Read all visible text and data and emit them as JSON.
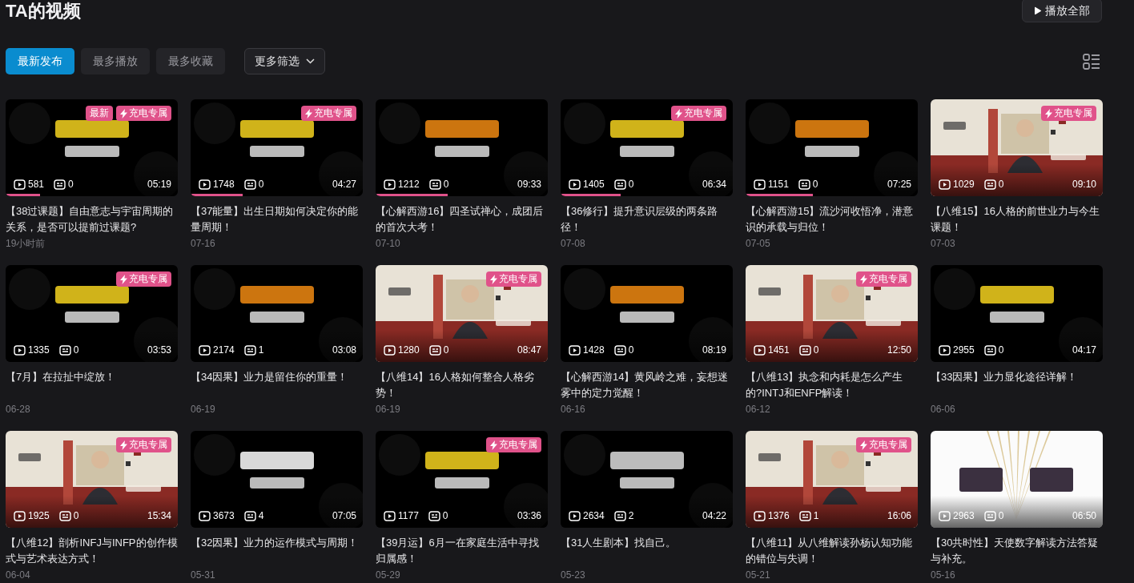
{
  "page_title": "TA的视频",
  "play_all_button": "播放全部",
  "sort_tabs": [
    {
      "label": "最新发布",
      "selected": true
    },
    {
      "label": "最多播放",
      "selected": false
    },
    {
      "label": "最多收藏",
      "selected": false
    }
  ],
  "more_filter": "更多筛选",
  "videos": [
    {
      "thumbnail": {
        "kind": "picture"
      },
      "badges": [
        {
          "kind": "new",
          "label": "最新"
        },
        {
          "kind": "charge",
          "label": "充电专属"
        }
      ],
      "plays": "581",
      "danmaku": "0",
      "duration": "05:19",
      "level": 0.2,
      "title": "【38过课题】自由意志与宇宙周期的关系，是否可以提前过课题?",
      "date": "19小时前"
    },
    {
      "thumbnail": {
        "kind": "picture"
      },
      "badges": [
        {
          "kind": "charge",
          "label": "充电专属"
        }
      ],
      "plays": "1748",
      "danmaku": "0",
      "duration": "04:27",
      "level": 0.3,
      "title": "【37能量】出生日期如何决定你的能量周期！",
      "date": "07-16"
    },
    {
      "thumbnail": {
        "kind": "picture"
      },
      "plays": "1212",
      "danmaku": "0",
      "duration": "09:33",
      "level": 0.42,
      "title": "【心解西游16】四圣试禅心，成团后的首次大考！",
      "date": "07-10"
    },
    {
      "thumbnail": {
        "kind": "picture"
      },
      "badges": [
        {
          "kind": "charge",
          "label": "充电专属"
        }
      ],
      "plays": "1405",
      "danmaku": "0",
      "duration": "06:34",
      "level": 0.35,
      "title": "【36修行】提升意识层级的两条路径！",
      "date": "07-08"
    },
    {
      "thumbnail": {
        "kind": "picture"
      },
      "plays": "1151",
      "danmaku": "0",
      "duration": "07:25",
      "level": 0.39,
      "title": "【心解西游15】流沙河收悟净，潜意识的承载与归位！",
      "date": "07-05"
    },
    {
      "thumbnail": {
        "kind": "picture"
      },
      "badges": [
        {
          "kind": "charge",
          "label": "充电专属"
        }
      ],
      "plays": "1029",
      "danmaku": "0",
      "duration": "09:10",
      "title": "【八维15】16人格的前世业力与今生课题！",
      "date": "07-03"
    },
    {
      "thumbnail": {
        "kind": "picture"
      },
      "badges": [
        {
          "kind": "charge",
          "label": "充电专属"
        }
      ],
      "plays": "1335",
      "danmaku": "0",
      "duration": "03:53",
      "title": "【7月】在拉扯中绽放！",
      "date": "06-28"
    },
    {
      "thumbnail": {
        "kind": "picture"
      },
      "plays": "2174",
      "danmaku": "1",
      "duration": "03:08",
      "title": "【34因果】业力是留住你的重量！",
      "date": "06-19"
    },
    {
      "thumbnail": {
        "kind": "picture"
      },
      "badges": [
        {
          "kind": "charge",
          "label": "充电专属"
        }
      ],
      "plays": "1280",
      "danmaku": "0",
      "duration": "08:47",
      "title": "【八维14】16人格如何整合人格劣势！",
      "date": "06-19"
    },
    {
      "thumbnail": {
        "kind": "picture"
      },
      "plays": "1428",
      "danmaku": "0",
      "duration": "08:19",
      "title": "【心解西游14】黄风岭之难，妄想迷雾中的定力觉醒！",
      "date": "06-16"
    },
    {
      "thumbnail": {
        "kind": "picture"
      },
      "badges": [
        {
          "kind": "charge",
          "label": "充电专属"
        }
      ],
      "plays": "1451",
      "danmaku": "0",
      "duration": "12:50",
      "title": "【八维13】执念和内耗是怎么产生的?INTJ和ENFP解读！",
      "date": "06-12"
    },
    {
      "thumbnail": {
        "kind": "picture"
      },
      "plays": "2955",
      "danmaku": "0",
      "duration": "04:17",
      "title": "【33因果】业力显化途径详解！",
      "date": "06-06"
    },
    {
      "thumbnail": {
        "kind": "picture"
      },
      "badges": [
        {
          "kind": "charge",
          "label": "充电专属"
        }
      ],
      "plays": "1925",
      "danmaku": "0",
      "duration": "15:34",
      "title": "【八维12】剖析INFJ与INFP的创作模式与艺术表达方式！",
      "date": "06-04"
    },
    {
      "thumbnail": {
        "kind": "picture"
      },
      "plays": "3673",
      "danmaku": "4",
      "duration": "07:05",
      "title": "【32因果】业力的运作模式与周期！",
      "date": "05-31"
    },
    {
      "thumbnail": {
        "kind": "picture"
      },
      "badges": [
        {
          "kind": "charge",
          "label": "充电专属"
        }
      ],
      "plays": "1177",
      "danmaku": "0",
      "duration": "03:36",
      "title": "【39月运】6月一在家庭生活中寻找归属感！",
      "date": "05-29"
    },
    {
      "thumbnail": {
        "kind": "picture"
      },
      "plays": "2634",
      "danmaku": "2",
      "duration": "04:22",
      "title": "【31人生剧本】找自己。",
      "date": "05-23"
    },
    {
      "thumbnail": {
        "kind": "picture"
      },
      "badges": [
        {
          "kind": "charge",
          "label": "充电专属"
        }
      ],
      "plays": "1376",
      "danmaku": "1",
      "duration": "16:06",
      "title": "【八维11】从八维解读孙杨认知功能的错位与失调！",
      "date": "05-21"
    },
    {
      "thumbnail": {
        "kind": "picture"
      },
      "plays": "2963",
      "danmaku": "0",
      "duration": "06:50",
      "title": "【30共时性】天使数字解读方法答疑与补充。",
      "date": "05-16"
    }
  ]
}
